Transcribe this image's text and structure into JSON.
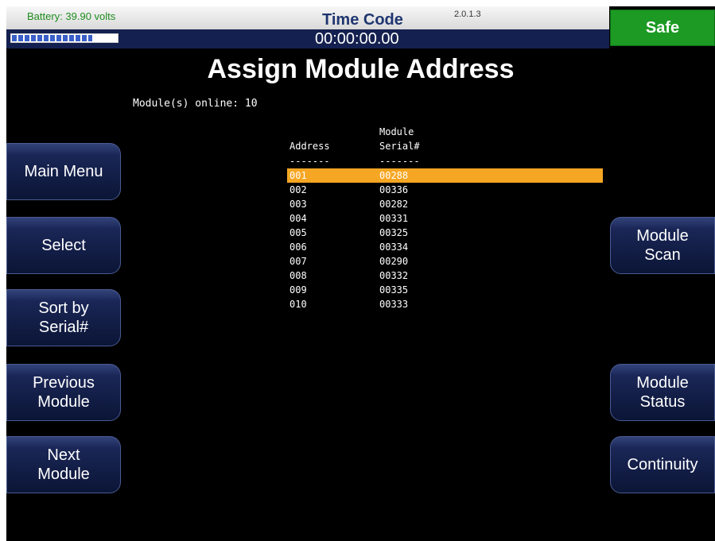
{
  "header": {
    "battery_label": "Battery: 39.90 volts",
    "battery_level": 0.75,
    "timecode_title": "Time Code",
    "version": "2.0.1.3",
    "timecode_value": "00:00:00.00",
    "safe_label": "Safe"
  },
  "page": {
    "title": "Assign Module Address",
    "modules_online": "Module(s) online: 10"
  },
  "table": {
    "col_address": "Address",
    "col_serial": "Module\nSerial#",
    "dashes": "-------",
    "rows": [
      {
        "address": "001",
        "serial": "00288"
      },
      {
        "address": "002",
        "serial": "00336"
      },
      {
        "address": "003",
        "serial": "00282"
      },
      {
        "address": "004",
        "serial": "00331"
      },
      {
        "address": "005",
        "serial": "00325"
      },
      {
        "address": "006",
        "serial": "00334"
      },
      {
        "address": "007",
        "serial": "00290"
      },
      {
        "address": "008",
        "serial": "00332"
      },
      {
        "address": "009",
        "serial": "00335"
      },
      {
        "address": "010",
        "serial": "00333"
      }
    ],
    "selected_index": 0
  },
  "left_buttons": {
    "main_menu": "Main Menu",
    "select": "Select",
    "sort_serial": "Sort by\nSerial#",
    "previous_module": "Previous\nModule",
    "next_module": "Next\nModule"
  },
  "right_buttons": {
    "module_scan": "Module\nScan",
    "module_status": "Module\nStatus",
    "continuity": "Continuity"
  },
  "colors": {
    "selected_row": "#f5a623",
    "safe": "#1c9a24",
    "battery_text": "#1f8d1f"
  }
}
